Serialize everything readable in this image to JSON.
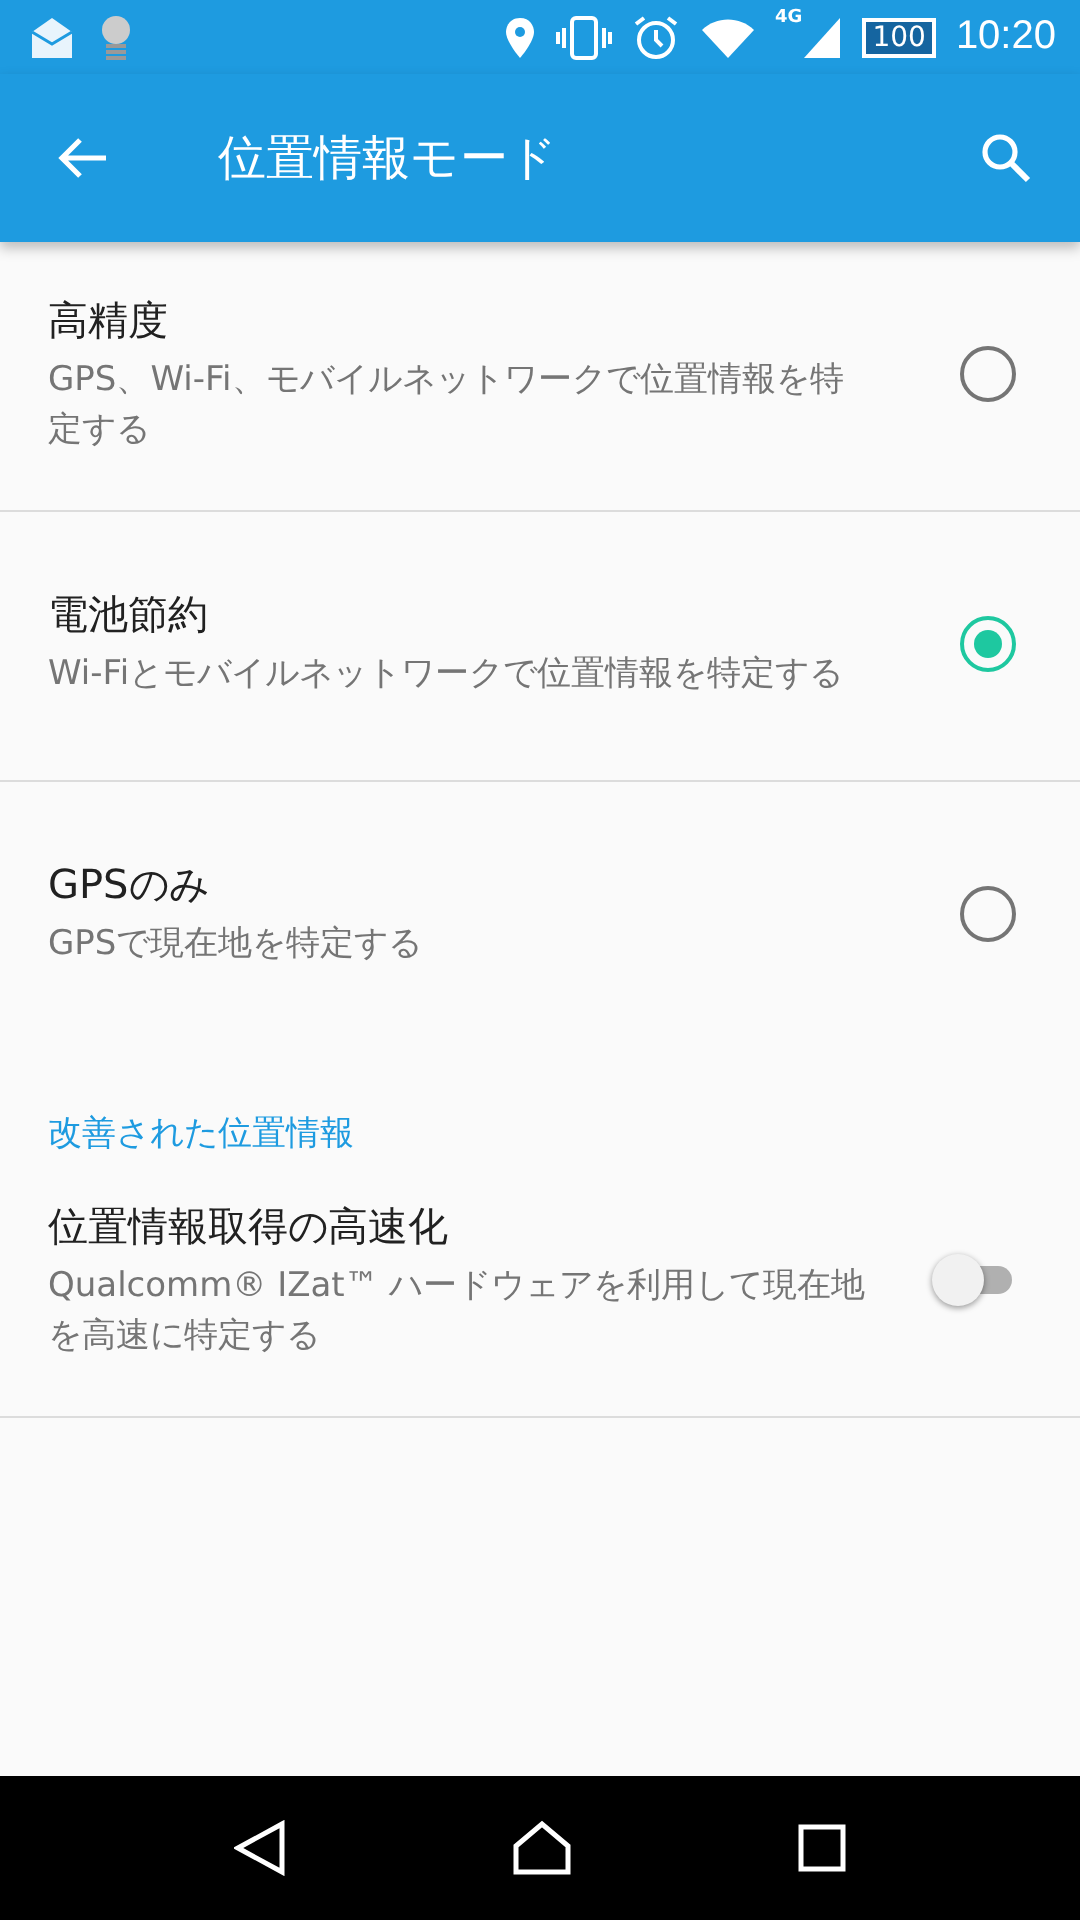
{
  "status_bar": {
    "network": "4G",
    "battery": "100",
    "time": "10:20"
  },
  "app_bar": {
    "title": "位置情報モード"
  },
  "modes": [
    {
      "title": "高精度",
      "description": "GPS、Wi-Fi、モバイルネットワークで位置情報を特定する",
      "selected": false
    },
    {
      "title": "電池節約",
      "description": "Wi-Fiとモバイルネットワークで位置情報を特定する",
      "selected": true
    },
    {
      "title": "GPSのみ",
      "description": "GPSで現在地を特定する",
      "selected": false
    }
  ],
  "section": {
    "header": "改善された位置情報",
    "setting": {
      "title": "位置情報取得の高速化",
      "description": "Qualcomm® IZat™ ハードウェアを利用して現在地を高速に特定する",
      "on": false
    }
  }
}
